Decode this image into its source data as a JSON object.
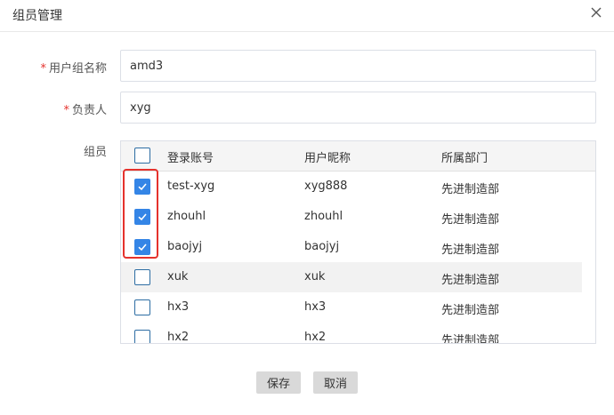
{
  "dialog": {
    "title": "组员管理"
  },
  "form": {
    "group_name": {
      "label": "用户组名称",
      "required_mark": "*",
      "value": "amd3"
    },
    "owner": {
      "label": "负责人",
      "required_mark": "*",
      "value": "xyg"
    },
    "members_label": "组员"
  },
  "table": {
    "headers": {
      "account": "登录账号",
      "nickname": "用户昵称",
      "department": "所属部门"
    },
    "rows": [
      {
        "account": "test-xyg",
        "nickname": "xyg888",
        "department": "先进制造部",
        "checked": true
      },
      {
        "account": "zhouhl",
        "nickname": "zhouhl",
        "department": "先进制造部",
        "checked": true
      },
      {
        "account": "baojyj",
        "nickname": "baojyj",
        "department": "先进制造部",
        "checked": true
      },
      {
        "account": "xuk",
        "nickname": "xuk",
        "department": "先进制造部",
        "checked": false
      },
      {
        "account": "hx3",
        "nickname": "hx3",
        "department": "先进制造部",
        "checked": false
      },
      {
        "account": "hx2",
        "nickname": "hx2",
        "department": "先进制造部",
        "checked": false
      }
    ]
  },
  "buttons": {
    "save": "保存",
    "cancel": "取消"
  },
  "colors": {
    "checkbox_checked": "#3485e6",
    "highlight_box": "#e5322d",
    "required_mark": "#e5322d"
  }
}
